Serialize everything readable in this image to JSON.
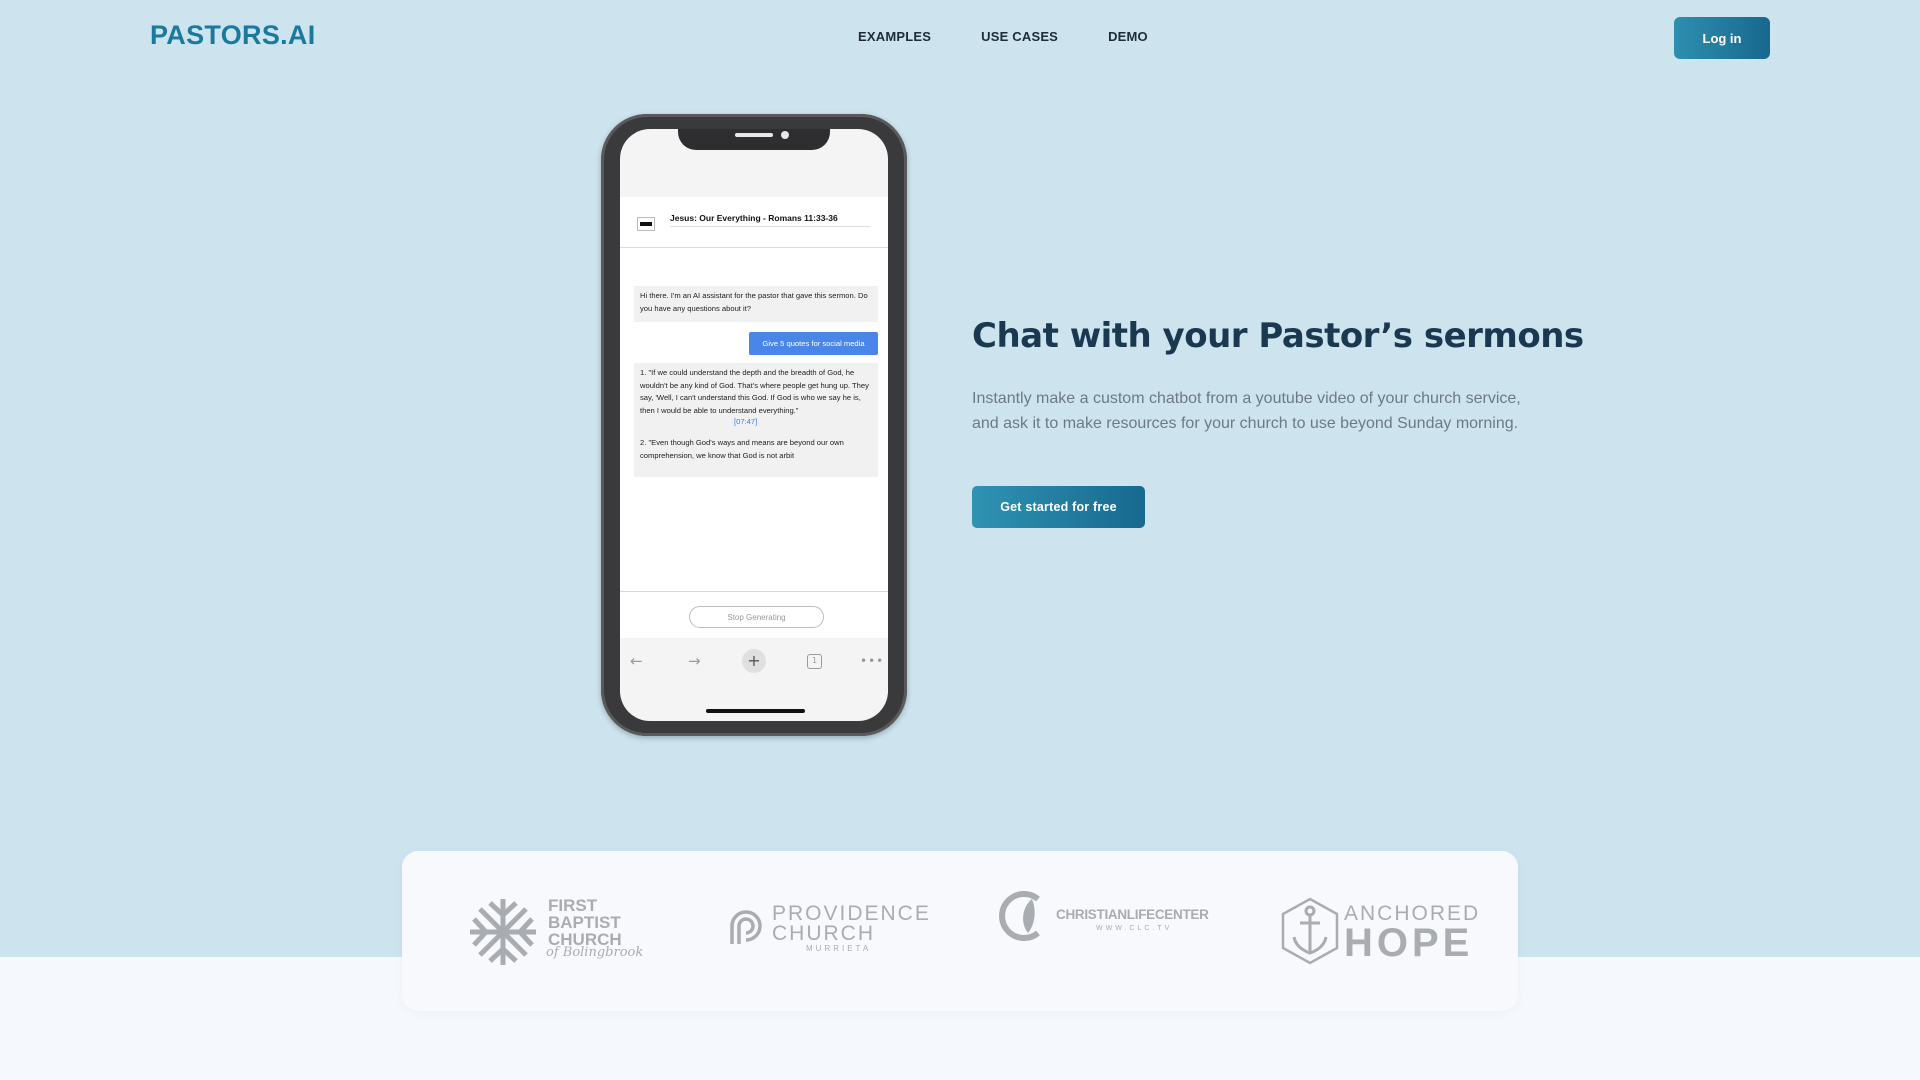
{
  "brand": {
    "name": "PASTORS.AI"
  },
  "nav": {
    "items": [
      "EXAMPLES",
      "USE CASES",
      "DEMO"
    ],
    "login_label": "Log in"
  },
  "phone": {
    "chat_title": "Jesus: Our Everything - Romans 11:33-36",
    "ai_greeting": "Hi there. I'm an AI assistant for the pastor that gave this sermon. Do you have any questions about it?",
    "user_message": "Give 5 quotes for social media",
    "ai_answer_1": "1. \"If we could understand the depth and the breadth of God, he wouldn't be any kind of God. That's where people get hung up. They say, 'Well, I can't understand this God. If God is who we say he is, then I would be able to understand everything.\"",
    "ai_answer_1_timestamp": "[07:47]",
    "ai_answer_2": "2. \"Even though God's ways and means are beyond our own comprehension, we know that God is not arbit",
    "stop_label": "Stop Generating",
    "browser_icons": [
      "arrow-left-icon",
      "arrow-right-icon",
      "plus-icon",
      "tabs-icon",
      "more-icon"
    ],
    "tab_count": "1"
  },
  "hero": {
    "title": "Chat with your Pastor’s sermons",
    "description": "Instantly make a custom chatbot from a youtube video of your church service, and ask it to make resources for your church to use beyond Sunday morning.",
    "cta_label": "Get started for free"
  },
  "church_logos": {
    "first_baptist": {
      "line1": "FIRST",
      "line2": "BAPTIST",
      "line3": "CHURCH",
      "script": "of Bolingbrook"
    },
    "providence": {
      "line1": "PROVIDENCE",
      "line2": "CHURCH",
      "sub": "MURRIETA"
    },
    "christian_life": {
      "name": "CHRISTIANLIFECENTER",
      "sub": "WWW.CLC.TV"
    },
    "anchored_hope": {
      "line1": "ANCHORED",
      "line2": "HOPE"
    }
  },
  "colors": {
    "hero_bg": "#cde3ee",
    "brand": "#1a7a9e",
    "heading": "#1b3851",
    "button_start": "#2f93b2",
    "button_end": "#17698f",
    "user_bubble": "#4a86e8"
  }
}
